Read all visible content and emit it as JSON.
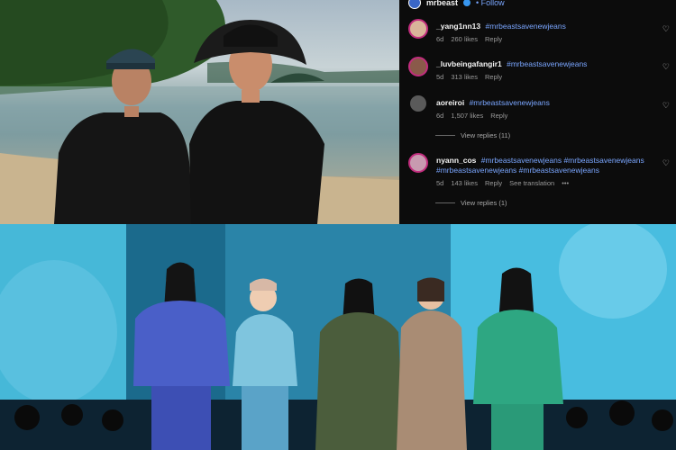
{
  "header": {
    "username": "mrbeast",
    "follow_label": "Follow",
    "verified_icon": "verified-badge-icon"
  },
  "comments": [
    {
      "username": "_yang1nn13",
      "text": "#mrbeastsavenewjeans",
      "age": "6d",
      "likes": "260 likes",
      "reply_label": "Reply"
    },
    {
      "username": "_luvbeingafangir1",
      "text": "#mrbeastsavenewjeans",
      "age": "5d",
      "likes": "313 likes",
      "reply_label": "Reply"
    },
    {
      "username": "aoreiroi",
      "text": "#mrbeastsavenewjeans",
      "age": "6d",
      "likes": "1,507 likes",
      "reply_label": "Reply",
      "view_replies": "View replies (11)"
    },
    {
      "username": "nyann_cos",
      "text": "#mrbeastsavenewjeans #mrbeastsavenewjeans #mrbeastsavenewjeans #mrbeastsavenewjeans",
      "age": "5d",
      "likes": "143 likes",
      "reply_label": "Reply",
      "see_translation": "See translation",
      "more": "•••",
      "view_replies": "View replies (1)"
    }
  ],
  "colors": {
    "panel_bg": "#0c0c0c",
    "hashtag": "#7aa6ff",
    "story_ring": "#c22d7e",
    "stage_blue": "#3aa6c9"
  },
  "icons": [
    "heart-icon",
    "ellipsis-icon"
  ]
}
